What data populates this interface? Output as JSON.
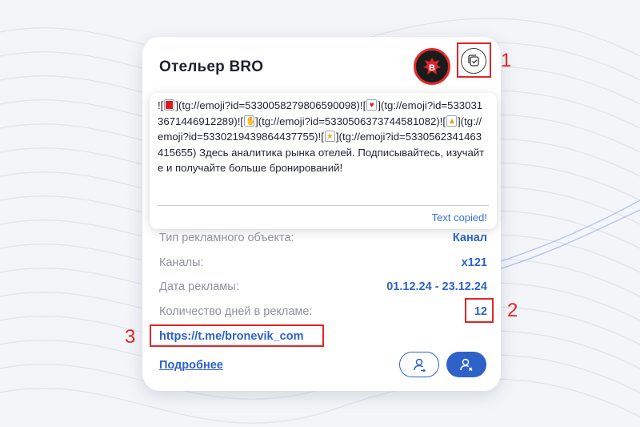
{
  "channel": {
    "title": "Отельер BRO",
    "avatar_letter": "B"
  },
  "post_text": {
    "segments": [
      {
        "t": "!["
      },
      {
        "emoji": "red-square"
      },
      {
        "t": "](tg://emoji?id=5330058279806590098)!["
      },
      {
        "emoji": "red-heart"
      },
      {
        "t": "](tg://emoji?id=5330313671446912289)!["
      },
      {
        "emoji": "hand"
      },
      {
        "t": "](tg://emoji?id=5330506373744581082)!["
      },
      {
        "emoji": "thumbs-up"
      },
      {
        "t": "](tg://emoji?id=5330219439864437755)!["
      },
      {
        "emoji": "star"
      },
      {
        "t": "](tg://emoji?id=5330562341463415655) Здесь аналитика рынка отелей. Подписывайтесь, изучайте и получайте больше бронирований!"
      }
    ]
  },
  "copy_status": "Text copied!",
  "fields": {
    "type_label": "Тип рекламного объекта:",
    "type_value": "Канал",
    "channels_label": "Каналы:",
    "channels_value": "x121",
    "date_label": "Дата рекламы:",
    "date_value": "01.12.24 - 23.12.24",
    "days_label": "Количество дней в рекламе:",
    "days_value": "12"
  },
  "link": "https://t.me/bronevik_com",
  "more_label": "Подробнее",
  "callouts": {
    "c1": "1",
    "c2": "2",
    "c3": "3"
  },
  "colors": {
    "accent": "#2e62c9",
    "highlight": "#e12626",
    "label": "#8e929c"
  }
}
